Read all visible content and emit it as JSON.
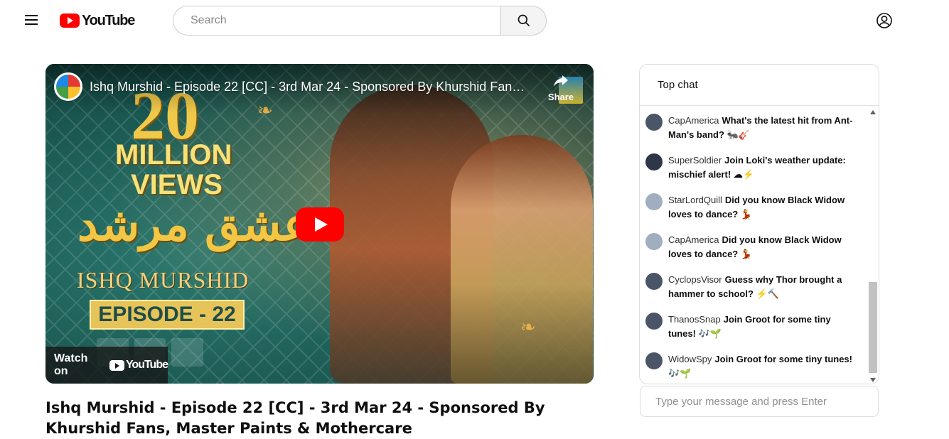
{
  "header": {
    "logo_text": "YouTube",
    "search_placeholder": "Search"
  },
  "player": {
    "overlay_title": "Ishq Murshid - Episode 22 [CC] - 3rd Mar 24 - Sponsored By Khurshid Fans, Master Paints & Mothercare",
    "share_label": "Share",
    "watch_on_label": "Watch on",
    "watch_on_brand": "YouTube",
    "thumbnail": {
      "count": "20",
      "million": "MILLION",
      "views": "VIEWS",
      "urdu_title": "عشق مرشد",
      "english_title": "ISHQ MURSHID",
      "episode": "EPISODE - 22"
    }
  },
  "video": {
    "title": "Ishq Murshid - Episode 22 [CC] - 3rd Mar 24 - Sponsored By Khurshid Fans, Master Paints & Mothercare"
  },
  "chat": {
    "header": "Top chat",
    "input_placeholder": "Type your message and press Enter",
    "messages": [
      {
        "author": "CapAmerica",
        "text": "What's the latest hit from Ant-Man's band? 🐜🎸",
        "avatar_color": "#4a5568"
      },
      {
        "author": "SuperSoldier",
        "text": "Join Loki's weather update: mischief alert! ☁⚡",
        "avatar_color": "#2d3748"
      },
      {
        "author": "StarLordQuill",
        "text": "Did you know Black Widow loves to dance? 💃",
        "avatar_color": "#a0aec0"
      },
      {
        "author": "CapAmerica",
        "text": "Did you know Black Widow loves to dance? 💃",
        "avatar_color": "#a0aec0"
      },
      {
        "author": "CyclopsVisor",
        "text": "Guess why Thor brought a hammer to school? ⚡🔨",
        "avatar_color": "#4a5568"
      },
      {
        "author": "ThanosSnap",
        "text": "Join Groot for some tiny tunes! 🎶🌱",
        "avatar_color": "#4a5568"
      },
      {
        "author": "WidowSpy",
        "text": "Join Groot for some tiny tunes! 🎶🌱",
        "avatar_color": "#4a5568"
      }
    ]
  },
  "colors": {
    "brand_red": "#ff0000",
    "text_primary": "#0f0f0f",
    "border": "#dddddd"
  }
}
